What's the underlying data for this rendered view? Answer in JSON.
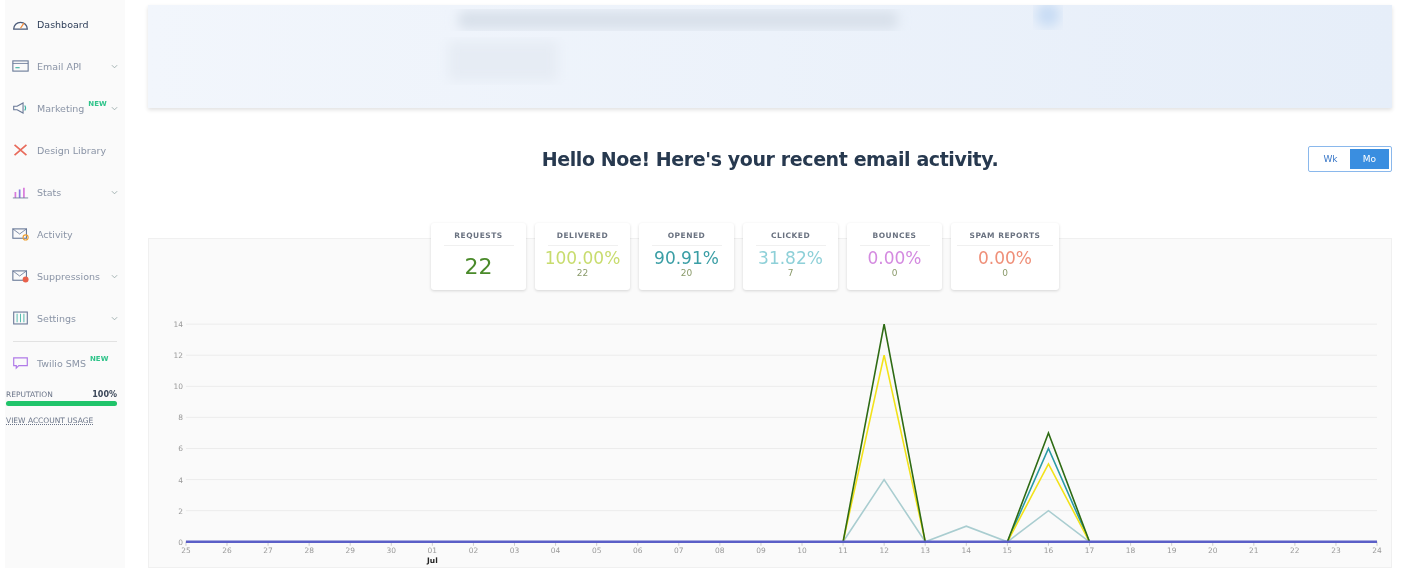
{
  "sidebar": {
    "items": [
      {
        "label": "Dashboard",
        "selected": true,
        "expandable": false
      },
      {
        "label": "Email API",
        "selected": false,
        "expandable": true
      },
      {
        "label": "Marketing",
        "badge": "NEW",
        "selected": false,
        "expandable": true
      },
      {
        "label": "Design Library",
        "selected": false,
        "expandable": false
      },
      {
        "label": "Stats",
        "selected": false,
        "expandable": true
      },
      {
        "label": "Activity",
        "selected": false,
        "expandable": false
      },
      {
        "label": "Suppressions",
        "selected": false,
        "expandable": true
      },
      {
        "label": "Settings",
        "selected": false,
        "expandable": true
      }
    ],
    "extra_items": [
      {
        "label": "Twilio SMS",
        "badge": "NEW",
        "selected": false
      }
    ],
    "reputation": {
      "label": "REPUTATION",
      "value": "100%",
      "level": 1
    },
    "usage_link": "VIEW ACCOUNT USAGE"
  },
  "greeting": "Hello Noe! Here's your recent email activity.",
  "period_toggle": [
    {
      "label": "Wk",
      "selected": false
    },
    {
      "label": "Mo",
      "selected": true
    }
  ],
  "stats": [
    {
      "label": "REQUESTS",
      "value": "22",
      "color": "#4a8a2a"
    },
    {
      "label": "DELIVERED",
      "value": "100.00%",
      "sub": "22",
      "color": "#c8dc6e"
    },
    {
      "label": "OPENED",
      "value": "90.91%",
      "sub": "20",
      "color": "#3a9ea5"
    },
    {
      "label": "CLICKED",
      "value": "31.82%",
      "sub": "7",
      "color": "#8ed0d8"
    },
    {
      "label": "BOUNCES",
      "value": "0.00%",
      "sub": "0",
      "color": "#d48ae0"
    },
    {
      "label": "SPAM REPORTS",
      "value": "0.00%",
      "sub": "0",
      "color": "#ef8f78"
    }
  ],
  "chart_data": {
    "type": "line",
    "categories": [
      "25",
      "26",
      "27",
      "28",
      "29",
      "30",
      "01",
      "02",
      "03",
      "04",
      "05",
      "06",
      "07",
      "08",
      "09",
      "10",
      "11",
      "12",
      "13",
      "14",
      "15",
      "16",
      "17",
      "18",
      "19",
      "20",
      "21",
      "22",
      "23",
      "24"
    ],
    "yticks": [
      0,
      2,
      4,
      6,
      8,
      10,
      12,
      14
    ],
    "ylim": [
      0,
      14
    ],
    "grid": true,
    "annotations": [
      {
        "x": "01",
        "y": 0,
        "text": "Jul"
      }
    ],
    "series": [
      {
        "color": "#a9cdd0",
        "values": [
          null,
          null,
          null,
          null,
          null,
          null,
          null,
          null,
          null,
          null,
          null,
          null,
          null,
          null,
          null,
          null,
          0,
          4,
          0,
          1,
          0,
          2,
          0,
          null,
          null,
          null,
          null,
          null,
          null,
          null
        ]
      },
      {
        "color": "#2a9aa5",
        "values": [
          null,
          null,
          null,
          null,
          null,
          null,
          null,
          null,
          null,
          null,
          null,
          null,
          null,
          null,
          null,
          null,
          null,
          null,
          null,
          null,
          0,
          6,
          0,
          null,
          null,
          null,
          null,
          null,
          null,
          null
        ]
      },
      {
        "color": "#f2e21a",
        "values": [
          null,
          null,
          null,
          null,
          null,
          null,
          null,
          null,
          null,
          null,
          null,
          null,
          null,
          null,
          null,
          null,
          0,
          12,
          0,
          null,
          0,
          5,
          0,
          null,
          null,
          null,
          null,
          null,
          null,
          null
        ]
      },
      {
        "color": "#2e6b14",
        "values": [
          null,
          null,
          null,
          null,
          null,
          null,
          null,
          null,
          null,
          null,
          null,
          null,
          null,
          null,
          null,
          null,
          0,
          14,
          0,
          null,
          0,
          7,
          0,
          null,
          null,
          null,
          null,
          null,
          null,
          null
        ]
      },
      {
        "color": "#5b5fc7",
        "values": [
          0,
          0,
          0,
          0,
          0,
          0,
          0,
          0,
          0,
          0,
          0,
          0,
          0,
          0,
          0,
          0,
          0,
          0,
          0,
          0,
          0,
          0,
          0,
          0,
          0,
          0,
          0,
          0,
          0,
          0
        ]
      }
    ]
  }
}
